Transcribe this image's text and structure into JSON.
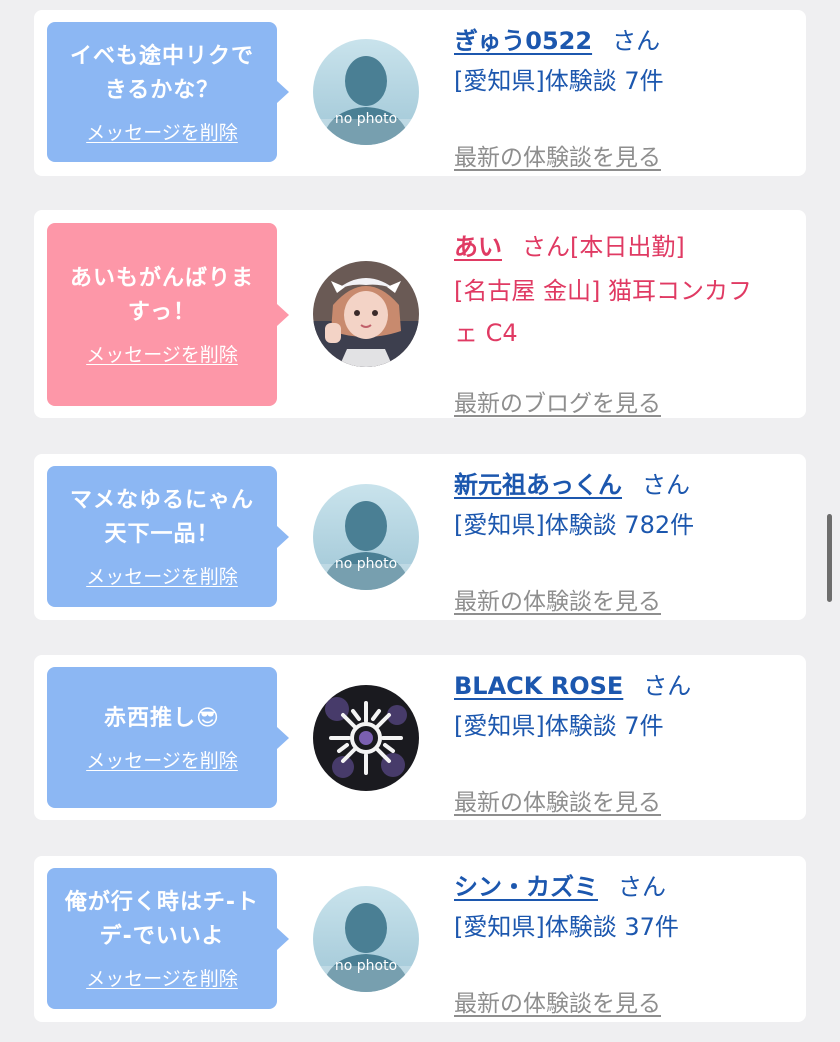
{
  "colors": {
    "bubble_blue": "#8cb7f3",
    "bubble_pink": "#fd97a8",
    "link_blue": "#1c57ae",
    "link_pink": "#e03a63",
    "muted": "#8e8e8e"
  },
  "cards": [
    {
      "bubble_lines": [
        "イベも途中リクで",
        "きるかな？"
      ],
      "delete_label": "メッセージを削除",
      "avatar_text": "no photo",
      "name": "ぎゅう0522",
      "suffix": "さん",
      "detail": "[愛知県]体験談 7件",
      "more_label": "最新の体験談を見る"
    },
    {
      "bubble_lines": [
        "あいもがんばりま",
        "すっ！"
      ],
      "delete_label": "メッセージを削除",
      "name": "あい",
      "suffix": "さん",
      "status": "[本日出勤]",
      "detail_lines": [
        "[名古屋 金山] 猫耳コンカフ",
        "ェ C4"
      ],
      "more_label": "最新のブログを見る"
    },
    {
      "bubble_lines": [
        "マメなゆるにゃん",
        "天下一品！"
      ],
      "delete_label": "メッセージを削除",
      "avatar_text": "no photo",
      "name": "新元祖あっくん",
      "suffix": "さん",
      "detail": "[愛知県]体験談 782件",
      "more_label": "最新の体験談を見る"
    },
    {
      "bubble_lines": [
        "赤西推し😎"
      ],
      "delete_label": "メッセージを削除",
      "name": "BLACK ROSE",
      "suffix": "さん",
      "detail": "[愛知県]体験談 7件",
      "more_label": "最新の体験談を見る"
    },
    {
      "bubble_lines": [
        "俺が行く時はチ-ト",
        "デ-でいいよ"
      ],
      "delete_label": "メッセージを削除",
      "avatar_text": "no photo",
      "name": "シン・カズミ",
      "suffix": "さん",
      "detail": "[愛知県]体験談 37件",
      "more_label": "最新の体験談を見る"
    }
  ]
}
